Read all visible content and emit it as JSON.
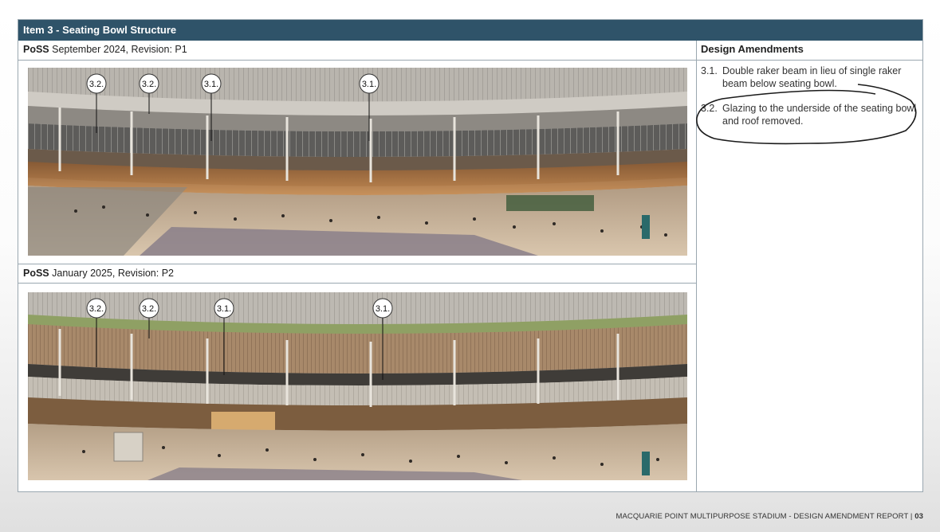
{
  "header": {
    "title": "Item 3 - Seating Bowl Structure"
  },
  "revisions": [
    {
      "bold": "PoSS",
      "label": " September 2024, Revision: P1",
      "callouts": [
        "3.2.",
        "3.2.",
        "3.1.",
        "3.1."
      ]
    },
    {
      "bold": "PoSS",
      "label": " January 2025, Revision: P2",
      "callouts": [
        "3.2.",
        "3.2.",
        "3.1.",
        "3.1."
      ]
    }
  ],
  "amendments": {
    "heading": "Design Amendments",
    "items": [
      {
        "num": "3.1.",
        "text": "Double raker beam in lieu of single raker beam below seating bowl."
      },
      {
        "num": "3.2.",
        "text": "Glazing to the underside of the seating bowl and roof removed."
      }
    ]
  },
  "footer": {
    "text": "MACQUARIE POINT MULTIPURPOSE STADIUM - DESIGN AMENDMENT REPORT | ",
    "page": "03"
  },
  "colors": {
    "header_bg": "#2f5369",
    "border": "#9aa7b0"
  }
}
